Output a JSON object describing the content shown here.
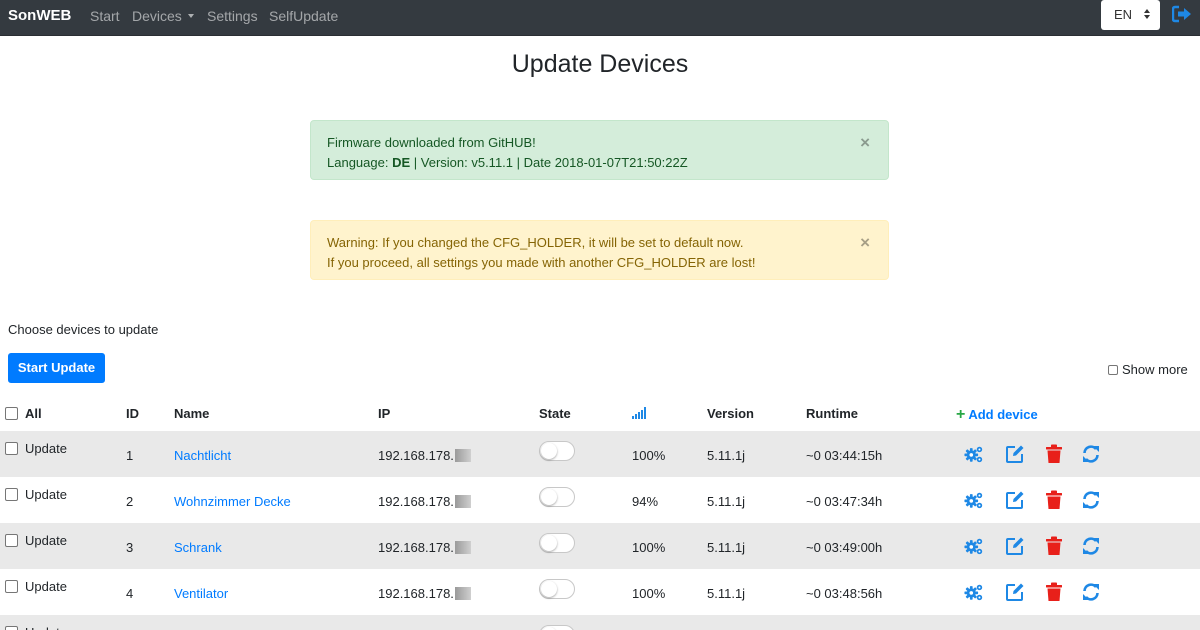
{
  "navbar": {
    "brand": "SonWEB",
    "items": [
      "Start",
      "Devices",
      "Settings",
      "SelfUpdate"
    ],
    "language": "EN"
  },
  "page": {
    "title": "Update Devices"
  },
  "alerts": {
    "success": {
      "line1": "Firmware downloaded from GitHUB!",
      "lang_label": "Language:",
      "lang_value": "DE",
      "rest": "| Version: v5.11.1 | Date 2018-01-07T21:50:22Z",
      "close": "×"
    },
    "warning": {
      "line1": "Warning: If you changed the CFG_HOLDER, it will be set to default now.",
      "line2": "If you proceed, all settings you made with another CFG_HOLDER are lost!",
      "close": "×"
    }
  },
  "controls": {
    "choose_text": "Choose devices to update",
    "start_button": "Start Update",
    "show_more": "Show more"
  },
  "table": {
    "headers": {
      "all": "All",
      "id": "ID",
      "name": "Name",
      "ip": "IP",
      "state": "State",
      "version": "Version",
      "runtime": "Runtime",
      "add_device": "Add device"
    },
    "rows": [
      {
        "check_label": "Update",
        "id": "1",
        "name": "Nachtlicht",
        "ip": "192.168.178.",
        "signal": "100%",
        "version": "5.11.1j",
        "runtime": "~0 03:44:15h"
      },
      {
        "check_label": "Update",
        "id": "2",
        "name": "Wohnzimmer Decke",
        "ip": "192.168.178.",
        "signal": "94%",
        "version": "5.11.1j",
        "runtime": "~0 03:47:34h"
      },
      {
        "check_label": "Update",
        "id": "3",
        "name": "Schrank",
        "ip": "192.168.178.",
        "signal": "100%",
        "version": "5.11.1j",
        "runtime": "~0 03:49:00h"
      },
      {
        "check_label": "Update",
        "id": "4",
        "name": "Ventilator",
        "ip": "192.168.178.",
        "signal": "100%",
        "version": "5.11.1j",
        "runtime": "~0 03:48:56h"
      },
      {
        "check_label": "Update"
      }
    ]
  },
  "colors": {
    "navbar_bg": "#343a40",
    "link_blue": "#007bff",
    "icon_blue": "#1e88e5",
    "delete_red": "#e8201a",
    "add_green": "#28a745"
  }
}
